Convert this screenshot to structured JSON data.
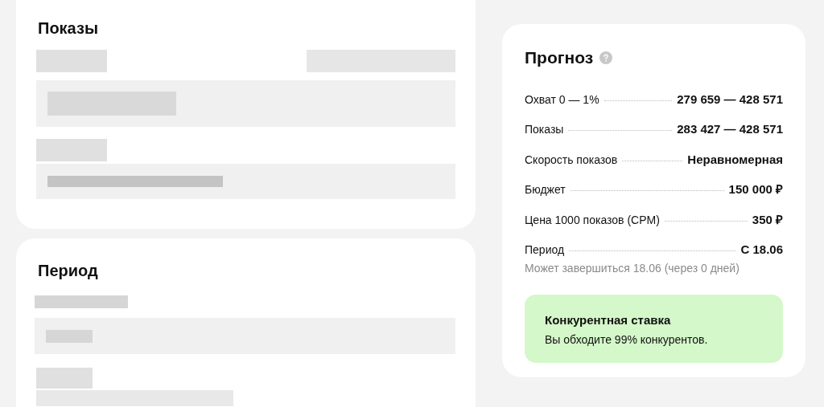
{
  "sections": [
    {
      "title": "Показы"
    },
    {
      "title": "Период"
    }
  ],
  "forecast": {
    "title": "Прогноз",
    "rows": [
      {
        "label": "Охват 0 — 1%",
        "value": "279 659 — 428 571"
      },
      {
        "label": "Показы",
        "value": "283 427 — 428 571"
      },
      {
        "label": "Скорость показов",
        "value": "Неравномерная"
      },
      {
        "label": "Бюджет",
        "value": "150 000 ₽"
      },
      {
        "label": "Цена 1000 показов (CPM)",
        "value": "350 ₽"
      },
      {
        "label": "Период",
        "value": "С 18.06",
        "note": "Может завершиться 18.06 (через 0 дней)"
      }
    ],
    "notice": {
      "title": "Конкурентная ставка",
      "text": "Вы обходите 99% конкурентов."
    }
  }
}
